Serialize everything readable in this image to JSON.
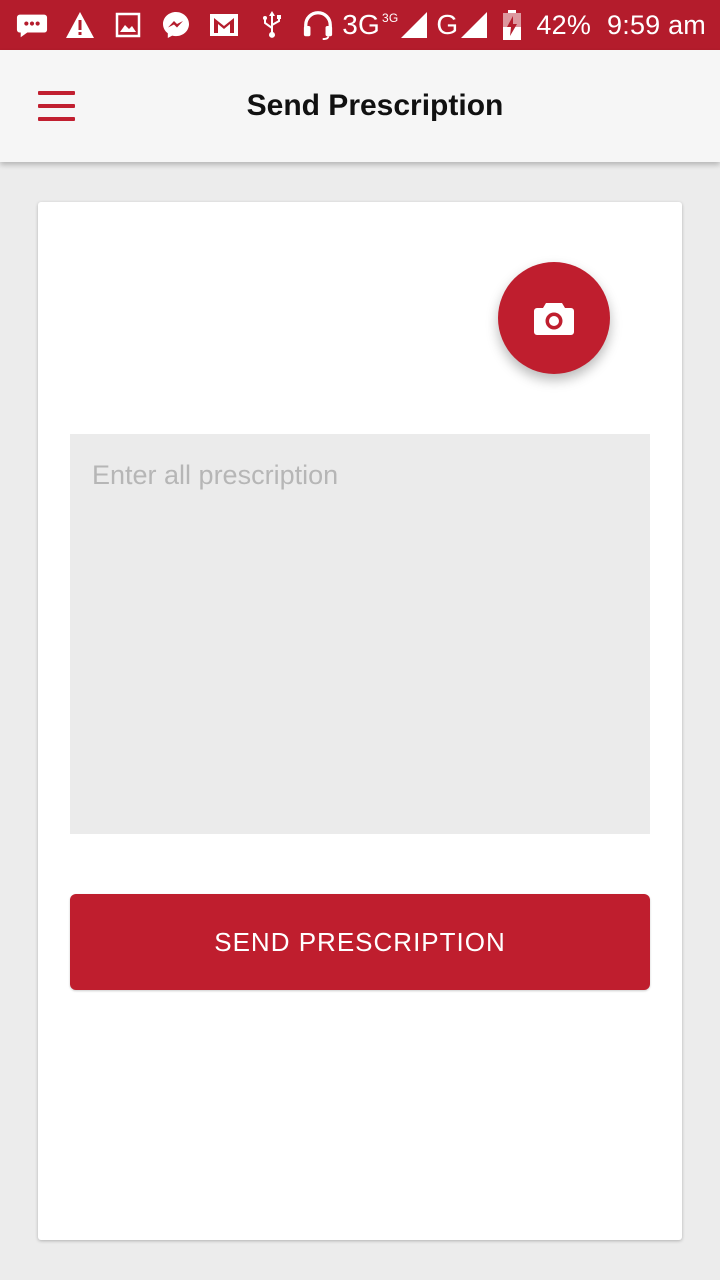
{
  "status_bar": {
    "icons": [
      "message-icon",
      "warning-icon",
      "image-icon",
      "messenger-icon",
      "gmail-icon",
      "usb-icon",
      "headset-icon"
    ],
    "network_main": "3G",
    "network_sup": "3G",
    "network_secondary": "G",
    "battery_percent": "42%",
    "time": "9:59 am"
  },
  "app_bar": {
    "title": "Send Prescription",
    "menu_icon": "hamburger-menu-icon"
  },
  "form": {
    "camera_icon": "camera-icon",
    "prescription_placeholder": "Enter all prescription",
    "prescription_value": "",
    "send_label": "SEND PRESCRIPTION"
  },
  "colors": {
    "primary": "#bf1e2e",
    "status_bar": "#b41c2c",
    "background": "#ececec",
    "input_bg": "#ebebeb"
  }
}
